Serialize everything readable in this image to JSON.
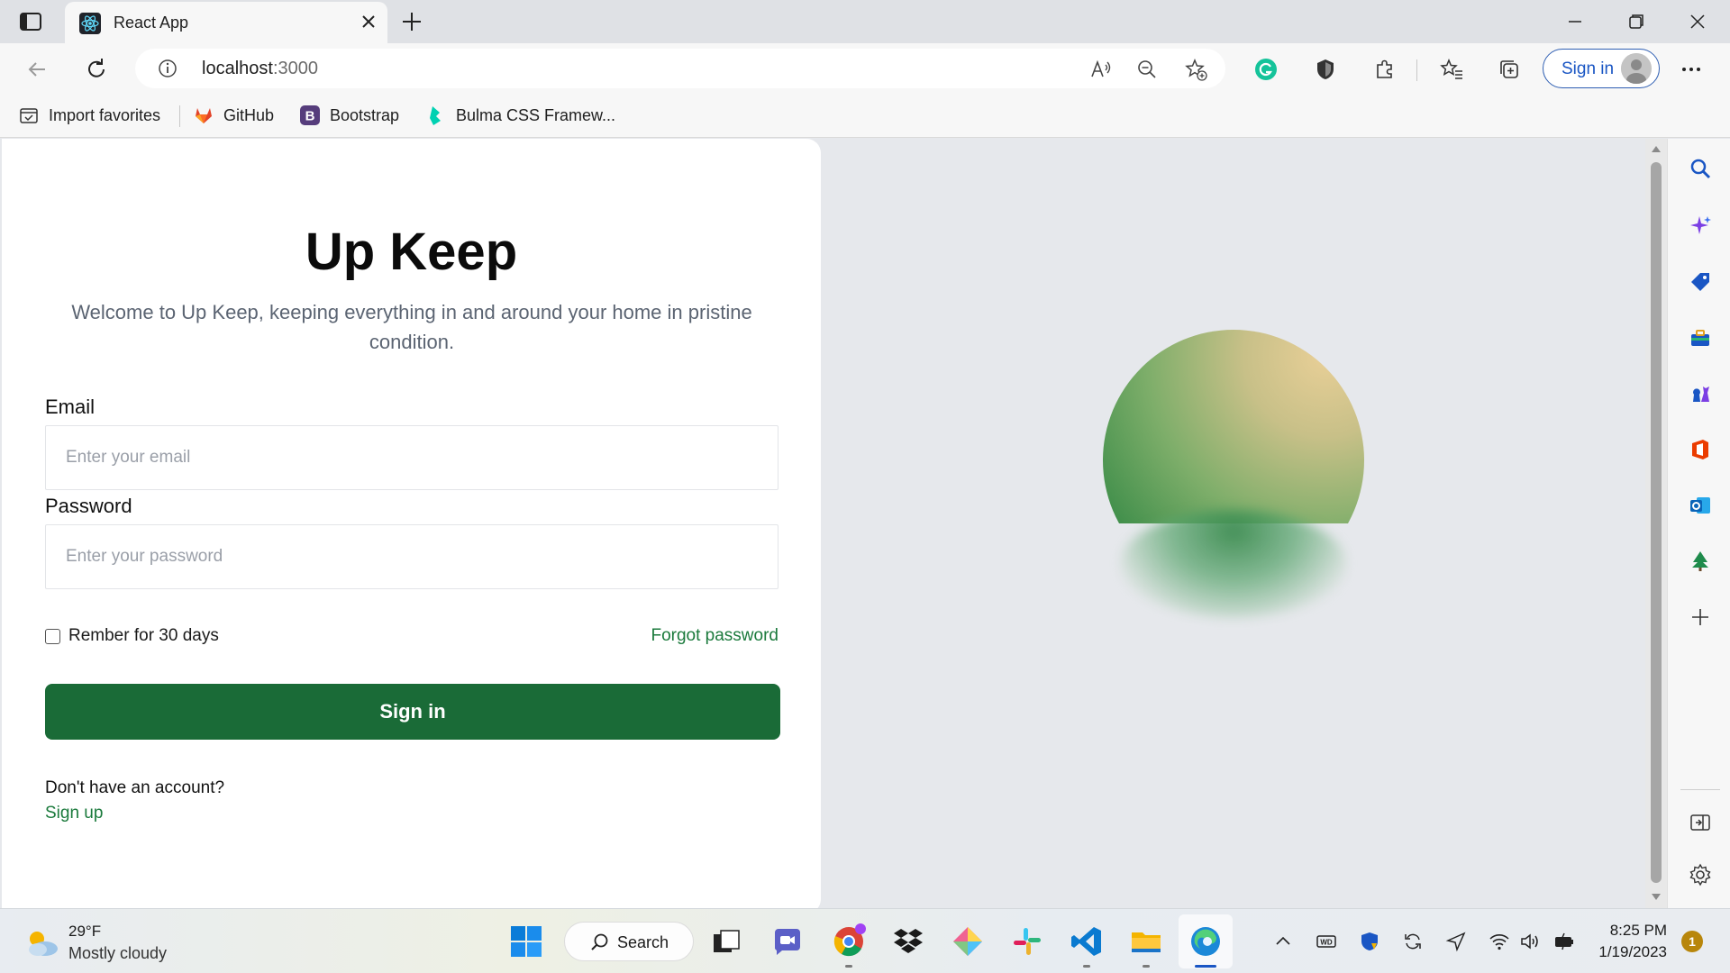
{
  "browser": {
    "tab_title": "React App",
    "url_host": "localhost",
    "url_port": ":3000",
    "signin_label": "Sign in"
  },
  "favorites": [
    {
      "label": "Import favorites",
      "icon": "import-favorites-icon"
    },
    {
      "label": "GitHub",
      "icon": "gitlab-fox-icon"
    },
    {
      "label": "Bootstrap",
      "icon": "bootstrap-icon"
    },
    {
      "label": "Bulma CSS Framew...",
      "icon": "bulma-icon"
    }
  ],
  "login": {
    "title": "Up Keep",
    "subtitle": "Welcome to Up Keep, keeping everything in and around your home in pristine condition.",
    "email_label": "Email",
    "email_placeholder": "Enter your email",
    "password_label": "Password",
    "password_placeholder": "Enter your password",
    "remember_label": "Rember for 30 days",
    "forgot_label": "Forgot password",
    "signin_button": "Sign in",
    "no_account": "Don't have an account?",
    "signup_link": "Sign up"
  },
  "colors": {
    "primary_green": "#1a6b37",
    "link_green": "#1b7a3c",
    "edge_blue": "#1a56c4"
  },
  "taskbar": {
    "weather_temp": "29°F",
    "weather_desc": "Mostly cloudy",
    "search_label": "Search",
    "time": "8:25 PM",
    "date": "1/19/2023",
    "notification_count": "1"
  }
}
